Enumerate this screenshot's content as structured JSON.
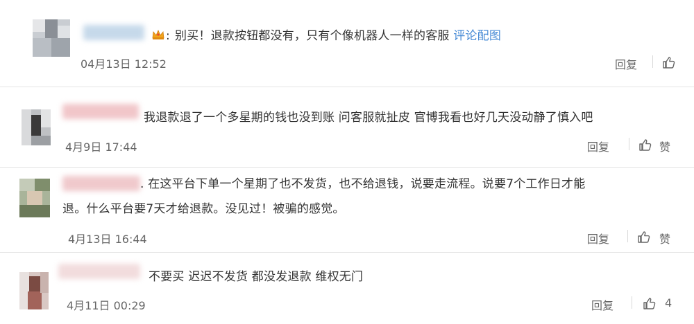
{
  "comments": [
    {
      "text": "别买！退款按钮都没有，只有个像机器人一样的客服",
      "link": "评论配图",
      "time": "04月13日 12:52",
      "reply": "回复",
      "like_label": ""
    },
    {
      "text": "我退款退了一个多星期的钱也没到账 问客服就扯皮 官博我看也好几天没动静了慎入吧",
      "time": "4月9日 17:44",
      "reply": "回复",
      "like_label": "赞"
    },
    {
      "text_line1": ". 在这平台下单一个星期了也不发货，也不给退钱，说要走流程。说要7个工作日才能",
      "text_line2": "退。什么平台要7天才给退款。没见过！被骗的感觉。",
      "time": "4月13日 16:44",
      "reply": "回复",
      "like_label": "赞"
    },
    {
      "text": "不要买  迟迟不发货  都没发退款  维权无门",
      "time": "4月11日 00:29",
      "reply": "回复",
      "like_label": "4"
    }
  ],
  "colors": {
    "link": "#4a8cd6",
    "divider": "#e3e3e3",
    "meta": "#666666"
  }
}
